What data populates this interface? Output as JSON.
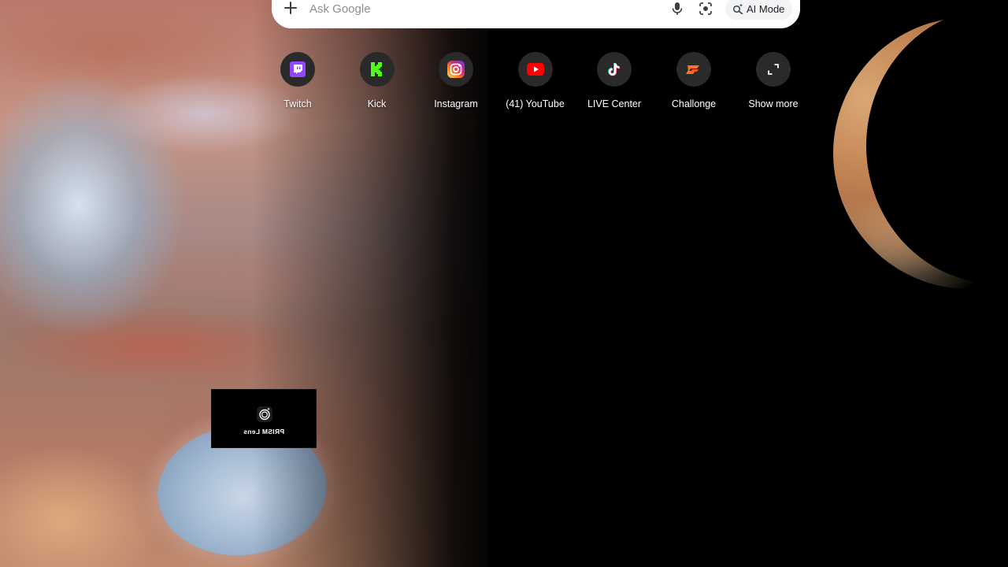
{
  "search": {
    "placeholder": "Ask Google",
    "add_icon": "plus-icon",
    "voice_icon": "microphone-icon",
    "lens_icon": "google-lens-icon",
    "ai_mode_label": "AI Mode",
    "ai_mode_icon": "sparkle-search-icon"
  },
  "shortcuts": [
    {
      "label": "Twitch",
      "icon": "twitch-icon",
      "color": "#9146FF"
    },
    {
      "label": "Kick",
      "icon": "kick-icon",
      "color": "#53FC18"
    },
    {
      "label": "Instagram",
      "icon": "instagram-icon",
      "color": "#E1306C"
    },
    {
      "label": "(41) YouTube",
      "icon": "youtube-icon",
      "color": "#FF0000"
    },
    {
      "label": "LIVE Center",
      "icon": "tiktok-icon",
      "color": "#000000"
    },
    {
      "label": "Challonge",
      "icon": "challonge-icon",
      "color": "#FF7324"
    },
    {
      "label": "Show more",
      "icon": "expand-icon",
      "color": "#FFFFFF"
    }
  ],
  "overlay": {
    "label": "PRISM Lens",
    "icon": "camera-lens-icon"
  }
}
